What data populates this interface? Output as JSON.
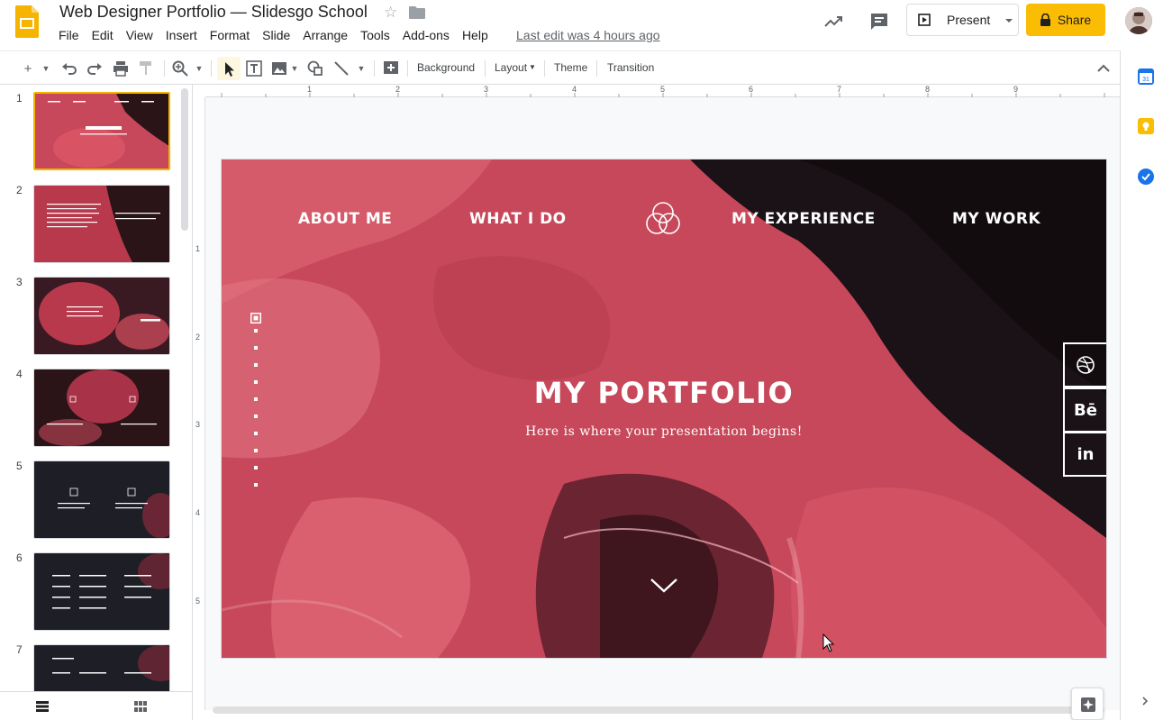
{
  "header": {
    "doc_title": "Web Designer Portfolio — Slidesgo School",
    "last_edit": "Last edit was 4 hours ago",
    "present_label": "Present",
    "share_label": "Share",
    "menu": [
      "File",
      "Edit",
      "View",
      "Insert",
      "Format",
      "Slide",
      "Arrange",
      "Tools",
      "Add-ons",
      "Help"
    ]
  },
  "toolbar": {
    "background_label": "Background",
    "layout_label": "Layout",
    "theme_label": "Theme",
    "transition_label": "Transition"
  },
  "ruler": {
    "h_marks": [
      "1",
      "2",
      "3",
      "4",
      "5",
      "6",
      "7",
      "8",
      "9"
    ],
    "v_marks": [
      "1",
      "2",
      "3",
      "4",
      "5"
    ]
  },
  "filmstrip": {
    "slides": [
      "1",
      "2",
      "3",
      "4",
      "5",
      "6",
      "7"
    ],
    "selected": "1"
  },
  "slide": {
    "nav": [
      "ABOUT ME",
      "WHAT I DO",
      "MY EXPERIENCE",
      "MY WORK"
    ],
    "title": "MY PORTFOLIO",
    "subtitle": "Here is where your presentation begins!",
    "social": [
      "dribbble-icon",
      "Bē",
      "in"
    ]
  },
  "colors": {
    "accent_yellow": "#fbbc04",
    "slide_red": "#c7485a",
    "slide_dark": "#1a1216"
  }
}
